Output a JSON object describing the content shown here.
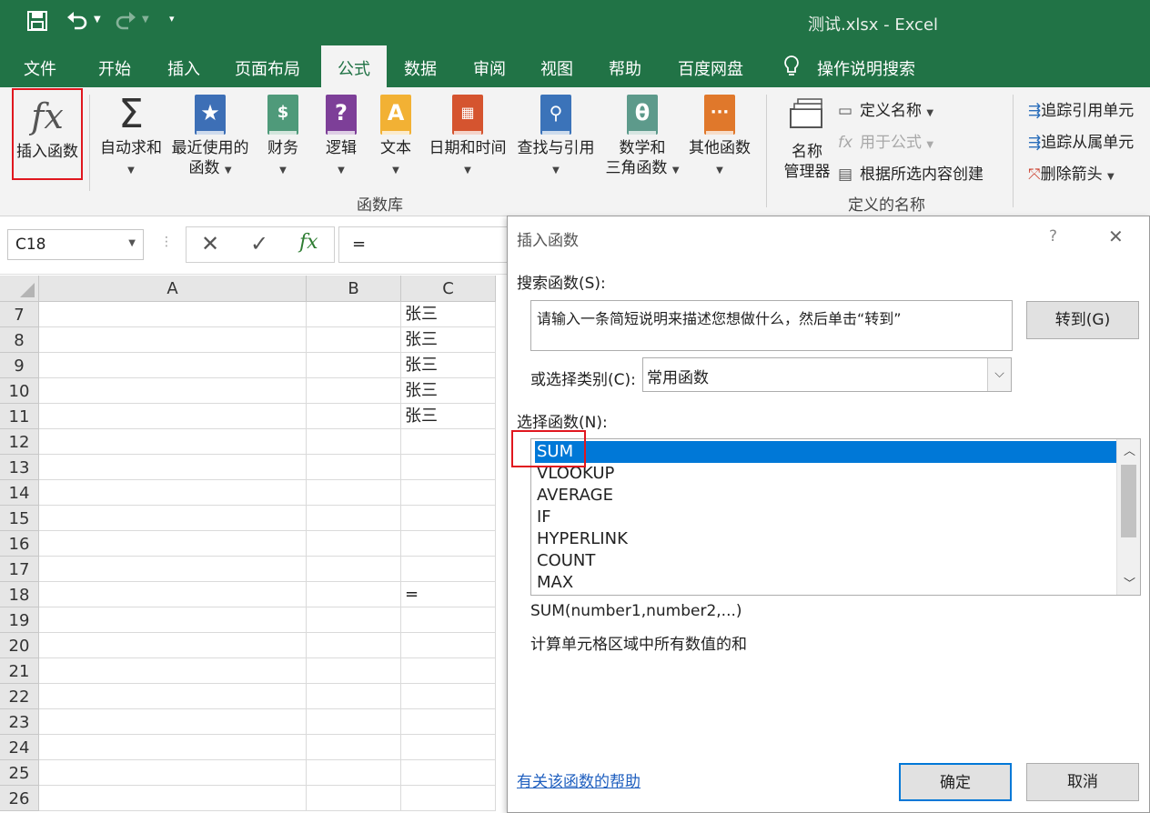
{
  "window": {
    "title": "测试.xlsx  -  Excel",
    "qat": {
      "save_icon": "save-icon",
      "undo_icon": "undo-icon",
      "redo_icon": "redo-icon",
      "customize_icon": "customize-qat-icon"
    }
  },
  "tabs": [
    {
      "label": "文件"
    },
    {
      "label": "开始"
    },
    {
      "label": "插入"
    },
    {
      "label": "页面布局"
    },
    {
      "label": "公式",
      "active": true
    },
    {
      "label": "数据"
    },
    {
      "label": "审阅"
    },
    {
      "label": "视图"
    },
    {
      "label": "帮助"
    },
    {
      "label": "百度网盘"
    }
  ],
  "tell_me": {
    "icon": "lightbulb-icon",
    "label": "操作说明搜索"
  },
  "ribbon": {
    "insert_function": {
      "label": "插入函数"
    },
    "autosum": {
      "label": "自动求和"
    },
    "recent": {
      "label1": "最近使用的",
      "label2": "函数"
    },
    "financial": {
      "label": "财务"
    },
    "logical": {
      "label": "逻辑"
    },
    "text": {
      "label": "文本"
    },
    "datetime": {
      "label": "日期和时间"
    },
    "lookup": {
      "label": "查找与引用"
    },
    "math": {
      "label1": "数学和",
      "label2": "三角函数"
    },
    "more": {
      "label": "其他函数"
    },
    "group_library": "函数库",
    "name_manager": {
      "label1": "名称",
      "label2": "管理器"
    },
    "define_name": "定义名称",
    "use_in_formula": "用于公式",
    "create_from_selection": "根据所选内容创建",
    "group_names": "定义的名称",
    "trace_precedents": "追踪引用单元",
    "trace_dependents": "追踪从属单元",
    "remove_arrows": "删除箭头"
  },
  "formula_bar": {
    "name_box": "C18",
    "content": "=",
    "cancel_icon": "cancel-icon",
    "enter_icon": "enter-icon",
    "fx_icon": "fx-icon"
  },
  "sheet": {
    "columns": [
      "A",
      "B",
      "C"
    ],
    "rows": [
      {
        "num": "7",
        "c": "张三"
      },
      {
        "num": "8",
        "c": "张三"
      },
      {
        "num": "9",
        "c": "张三"
      },
      {
        "num": "10",
        "c": "张三"
      },
      {
        "num": "11",
        "c": "张三"
      },
      {
        "num": "12",
        "c": ""
      },
      {
        "num": "13",
        "c": ""
      },
      {
        "num": "14",
        "c": ""
      },
      {
        "num": "15",
        "c": ""
      },
      {
        "num": "16",
        "c": ""
      },
      {
        "num": "17",
        "c": ""
      },
      {
        "num": "18",
        "c": "="
      },
      {
        "num": "19",
        "c": ""
      },
      {
        "num": "20",
        "c": ""
      },
      {
        "num": "21",
        "c": ""
      },
      {
        "num": "22",
        "c": ""
      },
      {
        "num": "23",
        "c": ""
      },
      {
        "num": "24",
        "c": ""
      },
      {
        "num": "25",
        "c": ""
      },
      {
        "num": "26",
        "c": ""
      }
    ]
  },
  "dialog": {
    "title": "插入函数",
    "help_glyph": "?",
    "close_glyph": "✕",
    "search_label": "搜索函数(S):",
    "search_value": "请输入一条简短说明来描述您想做什么，然后单击“转到”",
    "go_button": "转到(G)",
    "category_label": "或选择类别(C):",
    "category_value": "常用函数",
    "select_label": "选择函数(N):",
    "functions": [
      "SUM",
      "VLOOKUP",
      "AVERAGE",
      "IF",
      "HYPERLINK",
      "COUNT",
      "MAX"
    ],
    "selected_function": "SUM",
    "signature": "SUM(number1,number2,...)",
    "description": "计算单元格区域中所有数值的和",
    "help_link": "有关该函数的帮助",
    "ok_button": "确定",
    "cancel_button": "取消"
  },
  "colors": {
    "excel_green": "#217346",
    "selection_blue": "#0078d7",
    "highlight_red": "#e0171f"
  }
}
